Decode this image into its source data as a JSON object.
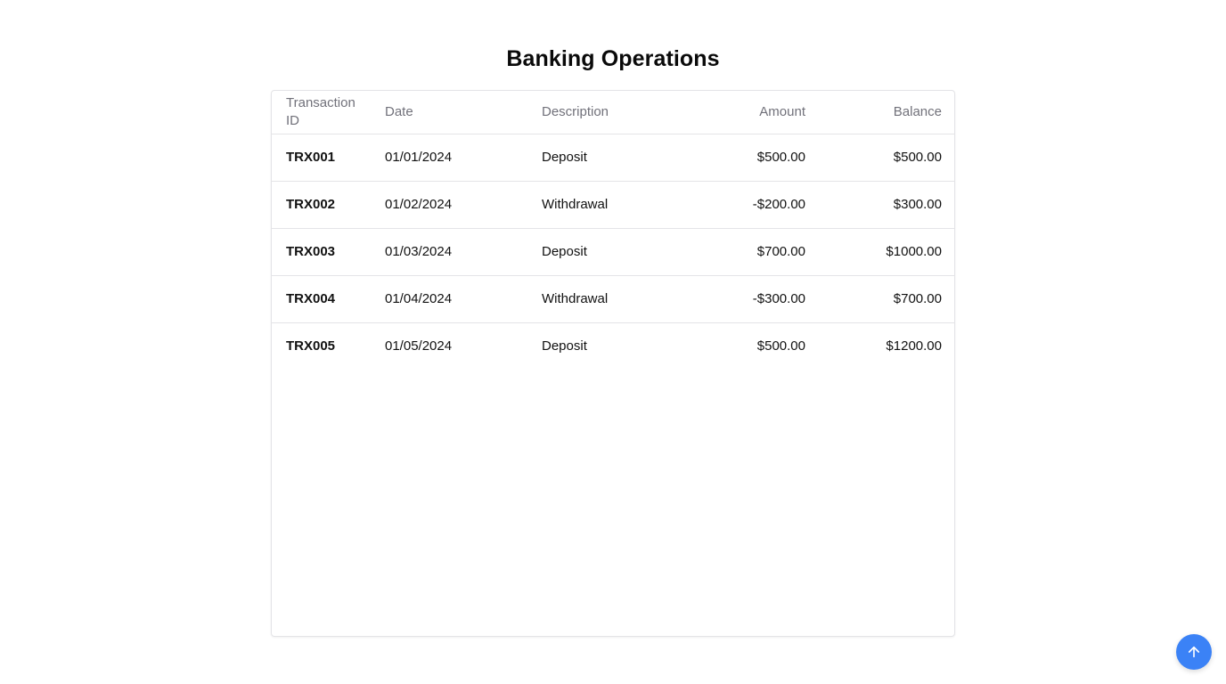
{
  "page": {
    "title": "Banking Operations"
  },
  "table": {
    "headers": {
      "transaction_id": "Transaction ID",
      "date": "Date",
      "description": "Description",
      "amount": "Amount",
      "balance": "Balance"
    },
    "rows": [
      {
        "id": "TRX001",
        "date": "01/01/2024",
        "description": "Deposit",
        "amount": "$500.00",
        "balance": "$500.00"
      },
      {
        "id": "TRX002",
        "date": "01/02/2024",
        "description": "Withdrawal",
        "amount": "-$200.00",
        "balance": "$300.00"
      },
      {
        "id": "TRX003",
        "date": "01/03/2024",
        "description": "Deposit",
        "amount": "$700.00",
        "balance": "$1000.00"
      },
      {
        "id": "TRX004",
        "date": "01/04/2024",
        "description": "Withdrawal",
        "amount": "-$300.00",
        "balance": "$700.00"
      },
      {
        "id": "TRX005",
        "date": "01/05/2024",
        "description": "Deposit",
        "amount": "$500.00",
        "balance": "$1200.00"
      }
    ]
  },
  "scroll_top_button": {
    "icon": "arrow-up-icon",
    "color": "#3b82f6"
  }
}
